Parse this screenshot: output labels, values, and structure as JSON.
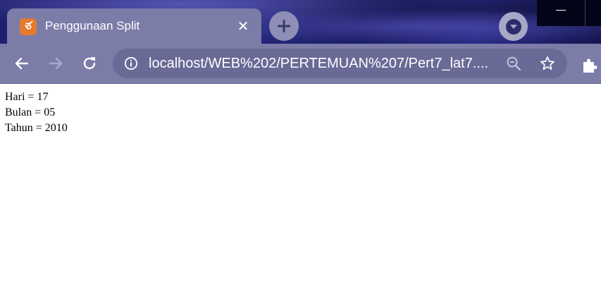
{
  "browser": {
    "tab_title": "Penggunaan Split",
    "tab_close_glyph": "✕",
    "url": "localhost/WEB%202/PERTEMUAN%207/Pert7_lat7....",
    "icons": {
      "favicon": "xampp-icon",
      "new_tab": "plus-icon",
      "profile": "profile-icon",
      "back": "back-arrow-icon",
      "forward": "forward-arrow-icon",
      "reload": "reload-icon",
      "site_info": "info-icon",
      "zoom": "zoom-out-icon",
      "bookmark": "star-icon",
      "extensions": "puzzle-icon",
      "minimize": "minimize-icon"
    },
    "colors": {
      "frame": "#7c7ca9",
      "omnibox": "#6a6a97",
      "theme_background": "#1e1f6e"
    }
  },
  "page": {
    "lines": [
      "Hari = 17",
      "Bulan = 05",
      "Tahun = 2010"
    ]
  }
}
